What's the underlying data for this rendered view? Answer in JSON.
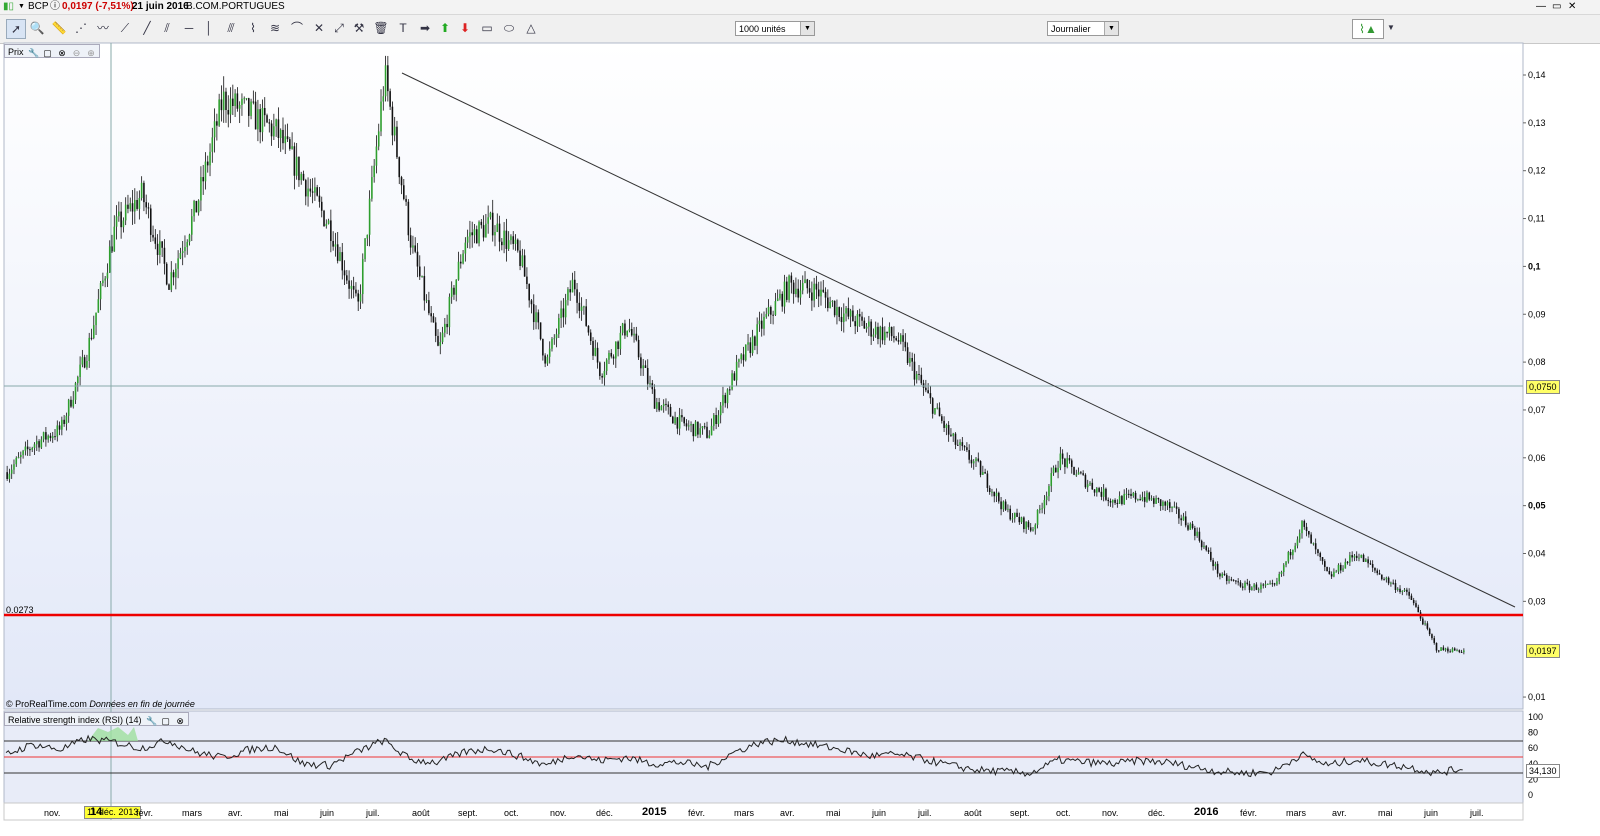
{
  "titlebar": {
    "symbol": "BCP",
    "change": "0,0197 (-7,51%)",
    "date": "21 juin 2016",
    "name": "B.COM.PORTUGUES"
  },
  "toolbar": {
    "units": "1000 unités",
    "period": "Journalier",
    "icons": [
      "cursor-icon",
      "magnifier-icon",
      "ruler-icon",
      "fan-icon",
      "wave-icon",
      "line-icon",
      "trendline-icon",
      "channel-icon",
      "hline-icon",
      "vline-icon",
      "parallel-icon",
      "zigzag-icon",
      "fibonacci-icon",
      "arc-icon",
      "cross-icon",
      "trend-icon",
      "hammer-icon",
      "trash-icon",
      "text-icon",
      "arrow-right-icon",
      "arrow-up-icon",
      "arrow-down-icon",
      "rect-icon",
      "ellipse-icon",
      "triangle-icon"
    ]
  },
  "price_panel": {
    "label": "Prix",
    "credit": "© ProRealTime.com",
    "credit_note": "Données en fin de journée",
    "support_value": "0.0273",
    "hline_value": "0,0750",
    "last_value": "0,0197"
  },
  "rsi_panel": {
    "label": "Relative strength index (RSI) (14)",
    "last_value": "34,130",
    "levels": [
      "100",
      "80",
      "60",
      "40",
      "20",
      "0"
    ]
  },
  "crosshair_date": "11 déc. 2013",
  "months": [
    {
      "label": "nov.",
      "bold": false
    },
    {
      "label": "14",
      "bold": true
    },
    {
      "label": "févr.",
      "bold": false
    },
    {
      "label": "mars",
      "bold": false
    },
    {
      "label": "avr.",
      "bold": false
    },
    {
      "label": "mai",
      "bold": false
    },
    {
      "label": "juin",
      "bold": false
    },
    {
      "label": "juil.",
      "bold": false
    },
    {
      "label": "août",
      "bold": false
    },
    {
      "label": "sept.",
      "bold": false
    },
    {
      "label": "oct.",
      "bold": false
    },
    {
      "label": "nov.",
      "bold": false
    },
    {
      "label": "déc.",
      "bold": false
    },
    {
      "label": "2015",
      "bold": true
    },
    {
      "label": "févr.",
      "bold": false
    },
    {
      "label": "mars",
      "bold": false
    },
    {
      "label": "avr.",
      "bold": false
    },
    {
      "label": "mai",
      "bold": false
    },
    {
      "label": "juin",
      "bold": false
    },
    {
      "label": "juil.",
      "bold": false
    },
    {
      "label": "août",
      "bold": false
    },
    {
      "label": "sept.",
      "bold": false
    },
    {
      "label": "oct.",
      "bold": false
    },
    {
      "label": "nov.",
      "bold": false
    },
    {
      "label": "déc.",
      "bold": false
    },
    {
      "label": "2016",
      "bold": true
    },
    {
      "label": "févr.",
      "bold": false
    },
    {
      "label": "mars",
      "bold": false
    },
    {
      "label": "avr.",
      "bold": false
    },
    {
      "label": "mai",
      "bold": false
    },
    {
      "label": "juin",
      "bold": false
    },
    {
      "label": "juil.",
      "bold": false
    }
  ],
  "chart_data": {
    "type": "line",
    "price_axis": [
      "0,14",
      "0,13",
      "0,12",
      "0,11",
      "0,1",
      "0,09",
      "0,08",
      "0,07",
      "0,06",
      "0,05",
      "0,04",
      "0,03",
      "0,01"
    ],
    "ylim": [
      0.01,
      0.142
    ],
    "series": [
      {
        "values": [
          0.057,
          0.063,
          0.066,
          0.083,
          0.108,
          0.115,
          0.097,
          0.112,
          0.135,
          0.132,
          0.128,
          0.118,
          0.108,
          0.091,
          0.14,
          0.104,
          0.082,
          0.106,
          0.109,
          0.102,
          0.08,
          0.097,
          0.078,
          0.088,
          0.072,
          0.067,
          0.065,
          0.078,
          0.088,
          0.096,
          0.095,
          0.09,
          0.087,
          0.085,
          0.074,
          0.064,
          0.058,
          0.049,
          0.045,
          0.06,
          0.055,
          0.051,
          0.052,
          0.05,
          0.045,
          0.035,
          0.033,
          0.033,
          0.046,
          0.035,
          0.04,
          0.035,
          0.031,
          0.02,
          0.0197
        ]
      },
      {
        "name": "RSI (14)",
        "values": [
          52,
          65,
          58,
          72,
          68,
          60,
          70,
          55,
          48,
          58,
          62,
          40,
          38,
          55,
          70,
          45,
          42,
          55,
          60,
          50,
          38,
          52,
          44,
          48,
          40,
          42,
          36,
          55,
          68,
          70,
          64,
          58,
          50,
          52,
          46,
          38,
          32,
          30,
          28,
          45,
          42,
          40,
          44,
          42,
          36,
          30,
          28,
          30,
          52,
          38,
          45,
          40,
          36,
          28,
          34
        ]
      }
    ]
  }
}
